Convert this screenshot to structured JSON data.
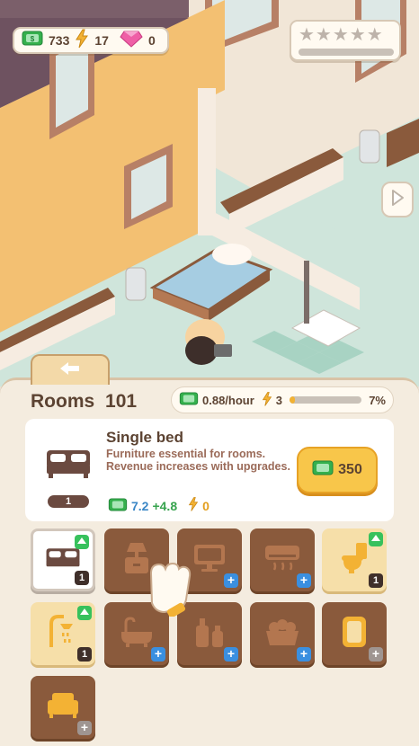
{
  "hud": {
    "money": "733",
    "energy": "17",
    "gems": "0",
    "star_rating": 0
  },
  "panel": {
    "room_label": "Rooms",
    "room_number": "101",
    "income": "0.88/hour",
    "energy_cost": "3",
    "progress_text": "7%",
    "progress_value": 0.07
  },
  "selected_item": {
    "name": "Single bed",
    "description": "Furniture essential for rooms. Revenue increases with upgrades.",
    "level": "1",
    "revenue": "7.2",
    "revenue_increase": "+4.8",
    "energy": "0",
    "price": "350"
  },
  "furniture": [
    {
      "icon": "bed-icon",
      "state": "selected",
      "level": "1",
      "upgradable": true
    },
    {
      "icon": "nightstand-lamp-icon",
      "state": "locked",
      "plus": "blue"
    },
    {
      "icon": "tv-icon",
      "state": "locked",
      "plus": "blue"
    },
    {
      "icon": "air-conditioner-icon",
      "state": "locked",
      "plus": "blue"
    },
    {
      "icon": "toilet-icon",
      "state": "owned",
      "level": "1",
      "upgradable": true
    },
    {
      "icon": "shower-icon",
      "state": "owned",
      "level": "1",
      "upgradable": true
    },
    {
      "icon": "bathtub-icon",
      "state": "locked",
      "plus": "blue"
    },
    {
      "icon": "toiletries-icon",
      "state": "locked",
      "plus": "blue"
    },
    {
      "icon": "fruit-basket-icon",
      "state": "locked",
      "plus": "blue"
    },
    {
      "icon": "mirror-icon",
      "state": "locked",
      "plus": "gray"
    },
    {
      "icon": "armchair-icon",
      "state": "locked",
      "plus": "gray"
    }
  ],
  "colors": {
    "money": "#35b04d",
    "energy": "#f3b234",
    "gem": "#ef5fa6",
    "upgrade": "#37c15c",
    "buy": "#f8c64a"
  }
}
